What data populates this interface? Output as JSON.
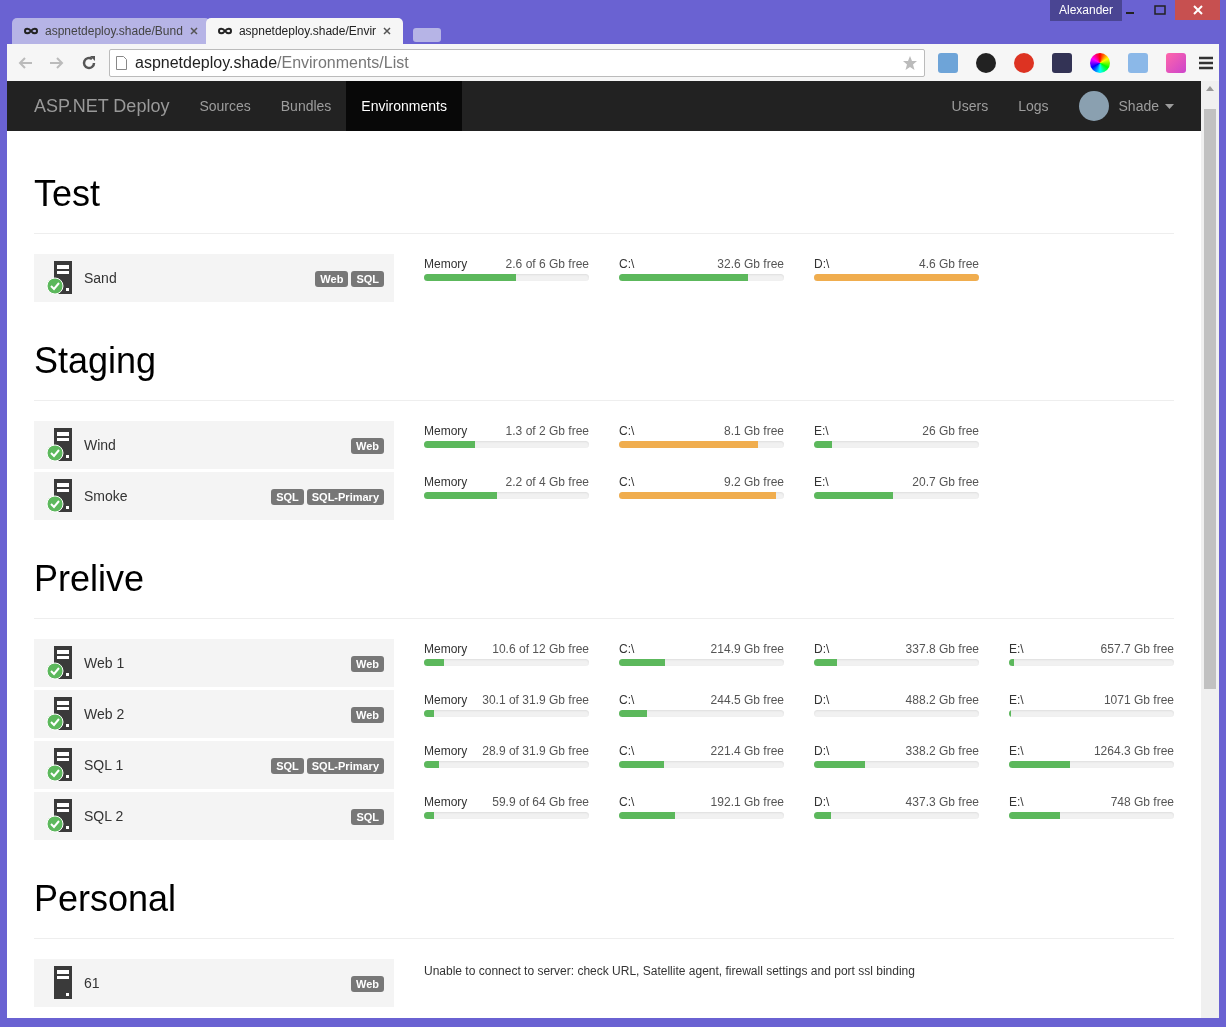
{
  "window": {
    "user": "Alexander"
  },
  "tabs": [
    {
      "title": "aspnetdeploy.shade/Bund",
      "selected": false
    },
    {
      "title": "aspnetdeploy.shade/Envir",
      "selected": true
    }
  ],
  "address": {
    "host": "aspnetdeploy.shade",
    "path": "/Environments/List"
  },
  "navbar": {
    "brand": "ASP.NET Deploy",
    "items": [
      {
        "label": "Sources",
        "selected": false
      },
      {
        "label": "Bundles",
        "selected": false
      },
      {
        "label": "Environments",
        "selected": true
      }
    ],
    "right_items": [
      {
        "label": "Users"
      },
      {
        "label": "Logs"
      }
    ],
    "user": "Shade"
  },
  "environments": [
    {
      "name": "Test",
      "servers": [
        {
          "name": "Sand",
          "online": true,
          "roles": [
            "Web",
            "SQL"
          ],
          "meters": [
            {
              "label": "Memory",
              "reading": "2.6 of 6 Gb free",
              "level": 0.56,
              "warning": false
            },
            {
              "label": "C:\\",
              "reading": "32.6 Gb free",
              "level": 0.78,
              "warning": false
            },
            {
              "label": "D:\\",
              "reading": "4.6 Gb free",
              "level": 1.0,
              "warning": true
            }
          ]
        }
      ]
    },
    {
      "name": "Staging",
      "servers": [
        {
          "name": "Wind",
          "online": true,
          "roles": [
            "Web"
          ],
          "meters": [
            {
              "label": "Memory",
              "reading": "1.3 of 2 Gb free",
              "level": 0.31,
              "warning": false
            },
            {
              "label": "C:\\",
              "reading": "8.1 Gb free",
              "level": 0.84,
              "warning": true
            },
            {
              "label": "E:\\",
              "reading": "26 Gb free",
              "level": 0.11,
              "warning": false
            }
          ]
        },
        {
          "name": "Smoke",
          "online": true,
          "roles": [
            "SQL",
            "SQL-Primary"
          ],
          "meters": [
            {
              "label": "Memory",
              "reading": "2.2 of 4 Gb free",
              "level": 0.44,
              "warning": false
            },
            {
              "label": "C:\\",
              "reading": "9.2 Gb free",
              "level": 0.95,
              "warning": true
            },
            {
              "label": "E:\\",
              "reading": "20.7 Gb free",
              "level": 0.48,
              "warning": false
            }
          ]
        }
      ]
    },
    {
      "name": "Prelive",
      "servers": [
        {
          "name": "Web 1",
          "online": true,
          "roles": [
            "Web"
          ],
          "meters": [
            {
              "label": "Memory",
              "reading": "10.6 of 12 Gb free",
              "level": 0.12,
              "warning": false
            },
            {
              "label": "C:\\",
              "reading": "214.9 Gb free",
              "level": 0.28,
              "warning": false
            },
            {
              "label": "D:\\",
              "reading": "337.8 Gb free",
              "level": 0.14,
              "warning": false
            },
            {
              "label": "E:\\",
              "reading": "657.7 Gb free",
              "level": 0.03,
              "warning": false
            }
          ]
        },
        {
          "name": "Web 2",
          "online": true,
          "roles": [
            "Web"
          ],
          "meters": [
            {
              "label": "Memory",
              "reading": "30.1 of 31.9 Gb free",
              "level": 0.06,
              "warning": false
            },
            {
              "label": "C:\\",
              "reading": "244.5 Gb free",
              "level": 0.17,
              "warning": false
            },
            {
              "label": "D:\\",
              "reading": "488.2 Gb free",
              "level": 0.0
            },
            {
              "label": "E:\\",
              "reading": "1071 Gb free",
              "level": 0.01,
              "warning": false
            }
          ]
        },
        {
          "name": "SQL 1",
          "online": true,
          "roles": [
            "SQL",
            "SQL-Primary"
          ],
          "meters": [
            {
              "label": "Memory",
              "reading": "28.9 of 31.9 Gb free",
              "level": 0.09,
              "warning": false
            },
            {
              "label": "C:\\",
              "reading": "221.4 Gb free",
              "level": 0.27,
              "warning": false
            },
            {
              "label": "D:\\",
              "reading": "338.2 Gb free",
              "level": 0.31,
              "warning": false
            },
            {
              "label": "E:\\",
              "reading": "1264.3 Gb free",
              "level": 0.37,
              "warning": false
            }
          ]
        },
        {
          "name": "SQL 2",
          "online": true,
          "roles": [
            "SQL"
          ],
          "meters": [
            {
              "label": "Memory",
              "reading": "59.9 of 64 Gb free",
              "level": 0.06,
              "warning": false
            },
            {
              "label": "C:\\",
              "reading": "192.1 Gb free",
              "level": 0.34,
              "warning": false
            },
            {
              "label": "D:\\",
              "reading": "437.3 Gb free",
              "level": 0.1,
              "warning": false
            },
            {
              "label": "E:\\",
              "reading": "748 Gb free",
              "level": 0.31,
              "warning": false
            }
          ]
        }
      ]
    },
    {
      "name": "Personal",
      "servers": [
        {
          "name": "61",
          "online": false,
          "roles": [
            "Web"
          ],
          "message": "Unable to connect to server: check URL, Satellite agent, firewall settings and port ssl binding"
        }
      ]
    }
  ]
}
